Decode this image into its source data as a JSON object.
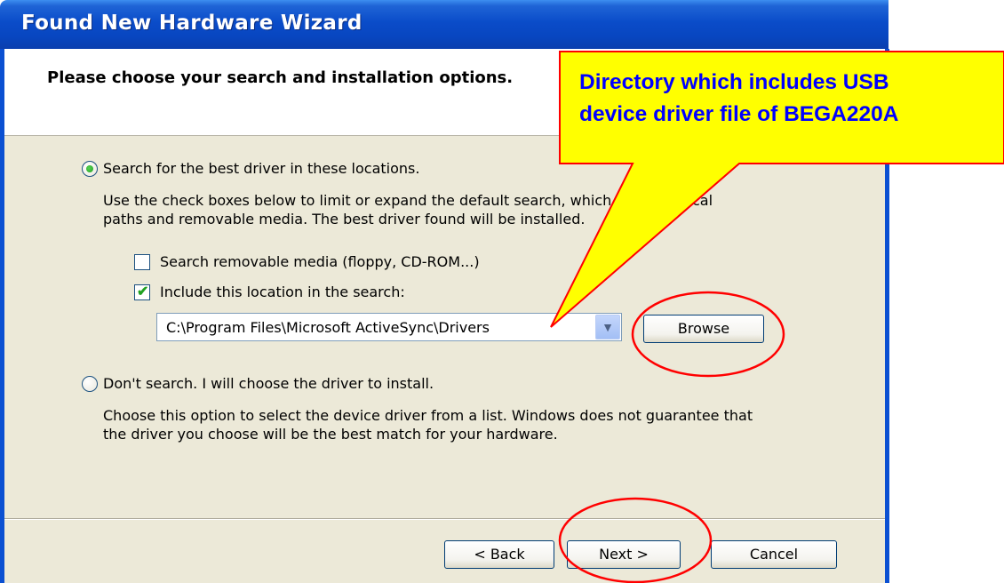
{
  "window": {
    "title": "Found New Hardware Wizard"
  },
  "header": {
    "text": "Please choose your search and installation options."
  },
  "options": {
    "search_label": "Search for the best driver in these locations.",
    "search_desc_line1": "Use the check boxes below to limit or expand the default search, which includes local",
    "search_desc_line2": "paths and removable media. The best driver found will be installed.",
    "removable_label": "Search removable media (floppy, CD-ROM...)",
    "removable_checked": false,
    "include_label": "Include this location in the search:",
    "include_checked": true,
    "location_value": "C:\\Program Files\\Microsoft ActiveSync\\Drivers",
    "browse_label": "Browse",
    "dont_search_label": "Don't search. I will choose the driver to install.",
    "dont_search_desc_line1": "Choose this option to select the device driver from a list.  Windows does not guarantee that",
    "dont_search_desc_line2": "the driver you choose will be the best match for your hardware.",
    "selected": "search"
  },
  "footer": {
    "back_label": "< Back",
    "next_label": "Next >",
    "cancel_label": "Cancel"
  },
  "callout": {
    "line1": "Directory which includes USB",
    "line2": "device driver file of BEGA220A",
    "fill_color": "#ffff00",
    "text_color": "#0000ff",
    "border_color": "#ff0000"
  },
  "highlight_color": "#ff0000"
}
